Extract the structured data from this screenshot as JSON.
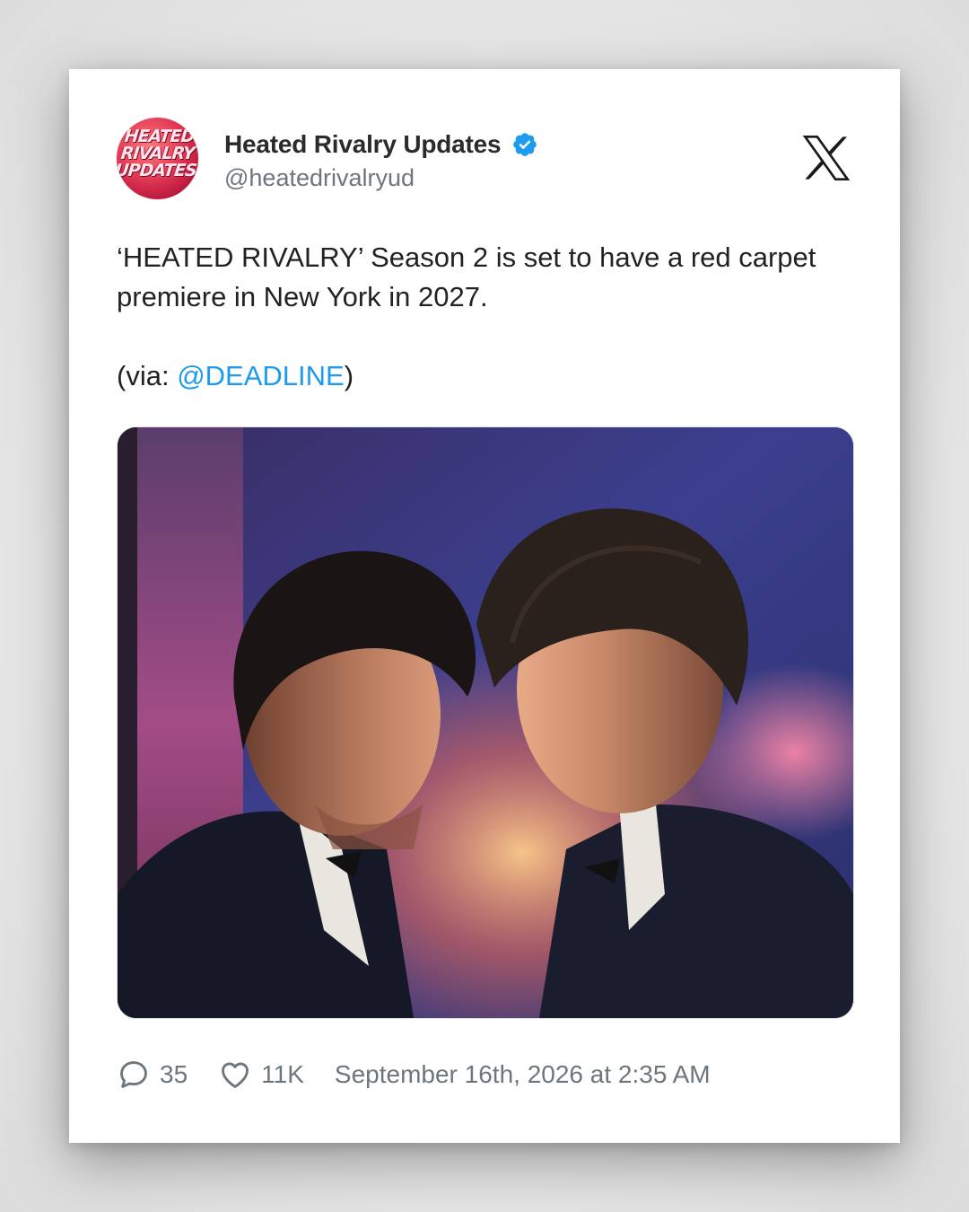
{
  "tweet": {
    "author": {
      "display_name": "Heated Rivalry Updates",
      "handle": "@heatedrivalryud",
      "verified": true,
      "avatar_text": "HEATED\nRIVALRY\nUPDATES"
    },
    "platform_icon": "x-logo-icon",
    "text_line1": "‘HEATED RIVALRY’ Season 2 is set to have a red carpet premiere in New York in 2027.",
    "via_prefix": "(via: ",
    "via_mention": "@DEADLINE",
    "via_suffix": ")",
    "image_icon": "photo-icon",
    "replies": "35",
    "likes": "11K",
    "timestamp": "September 16th, 2026 at 2:35 AM"
  },
  "colors": {
    "accent": "#1d9bf0",
    "text": "#222222",
    "muted": "#6e767d"
  }
}
